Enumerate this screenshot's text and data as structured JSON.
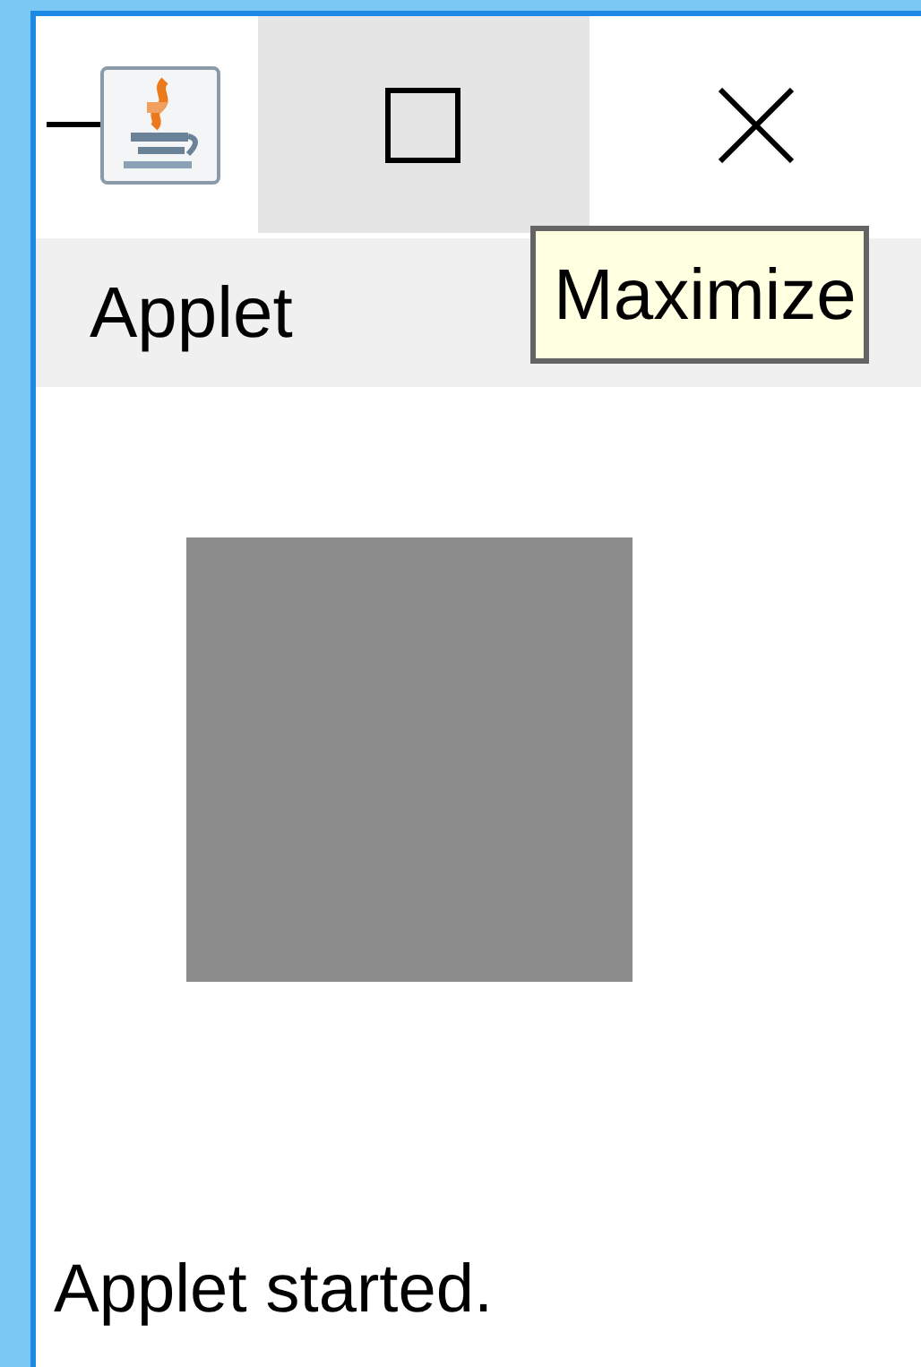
{
  "title_bar": {
    "buttons": [
      {
        "kind": "minimize",
        "hovered": false
      },
      {
        "kind": "maximize",
        "hovered": true
      },
      {
        "kind": "close",
        "hovered": false
      }
    ]
  },
  "menu_bar": {
    "items": [
      "Applet"
    ]
  },
  "tooltip": {
    "text": "Maximize"
  },
  "status_bar": {
    "text": "Applet started."
  }
}
